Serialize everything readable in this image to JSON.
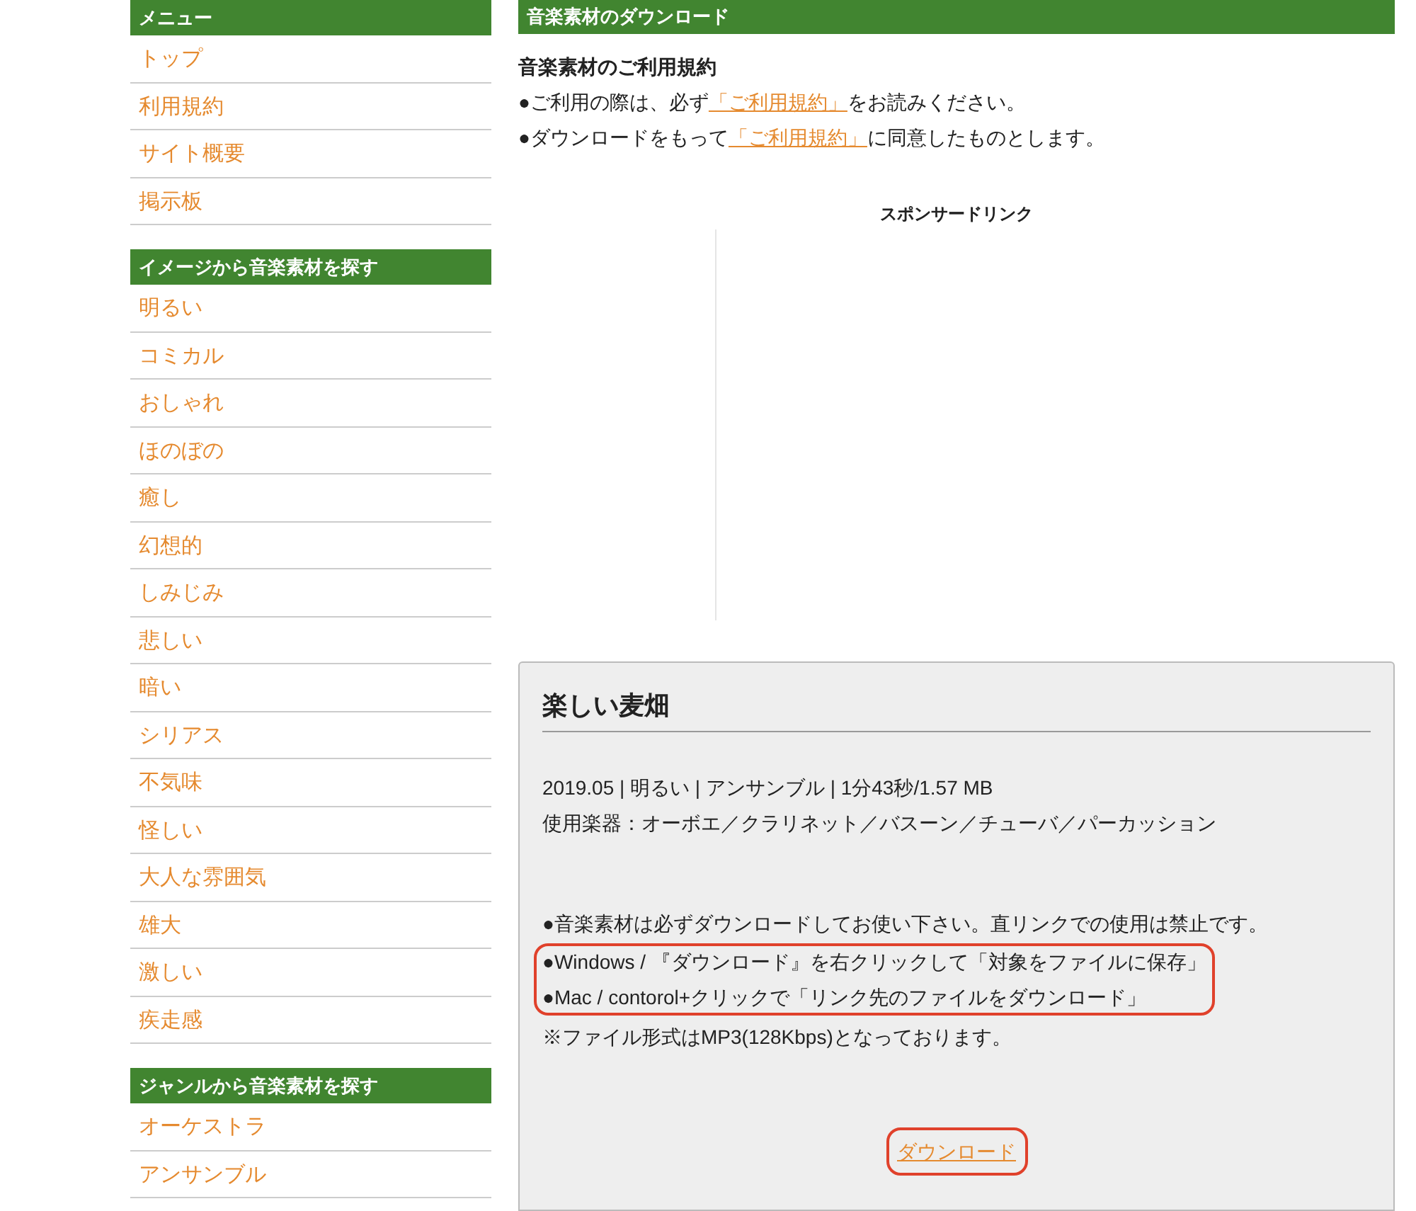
{
  "sidebar": {
    "sections": [
      {
        "title": "メニュー",
        "items": [
          "トップ",
          "利用規約",
          "サイト概要",
          "掲示板"
        ]
      },
      {
        "title": "イメージから音楽素材を探す",
        "items": [
          "明るい",
          "コミカル",
          "おしゃれ",
          "ほのぼの",
          "癒し",
          "幻想的",
          "しみじみ",
          "悲しい",
          "暗い",
          "シリアス",
          "不気味",
          "怪しい",
          "大人な雰囲気",
          "雄大",
          "激しい",
          "疾走感"
        ]
      },
      {
        "title": "ジャンルから音楽素材を探す",
        "items": [
          "オーケストラ",
          "アンサンブル"
        ]
      }
    ]
  },
  "main": {
    "title": "音楽素材のダウンロード",
    "terms": {
      "title": "音楽素材のご利用規約",
      "lines": [
        {
          "before": "●ご利用の際は、必ず",
          "link": "「ご利用規約」",
          "after": "をお読みください。"
        },
        {
          "before": "●ダウンロードをもって",
          "link": "「ご利用規約」",
          "after": "に同意したものとします。"
        }
      ]
    },
    "sponsor_label": "スポンサードリンク",
    "track": {
      "title": "楽しい麦畑",
      "meta": [
        "2019.05 | 明るい | アンサンブル | 1分43秒/1.57 MB",
        "使用楽器：オーボエ／クラリネット／バスーン／チューバ／パーカッション"
      ],
      "notes": [
        {
          "text": "●音楽素材は必ずダウンロードしてお使い下さい。直リンクでの使用は禁止です。",
          "highlighted": false
        },
        {
          "text": "●Windows / 『ダウンロード』を右クリックして「対象をファイルに保存」",
          "highlighted": true
        },
        {
          "text": "●Mac / contorol+クリックで「リンク先のファイルをダウンロード」",
          "highlighted": true
        },
        {
          "text": "※ファイル形式はMP3(128Kbps)となっております。",
          "highlighted": false
        }
      ],
      "download": {
        "label": "ダウンロード",
        "highlighted": true
      }
    }
  }
}
